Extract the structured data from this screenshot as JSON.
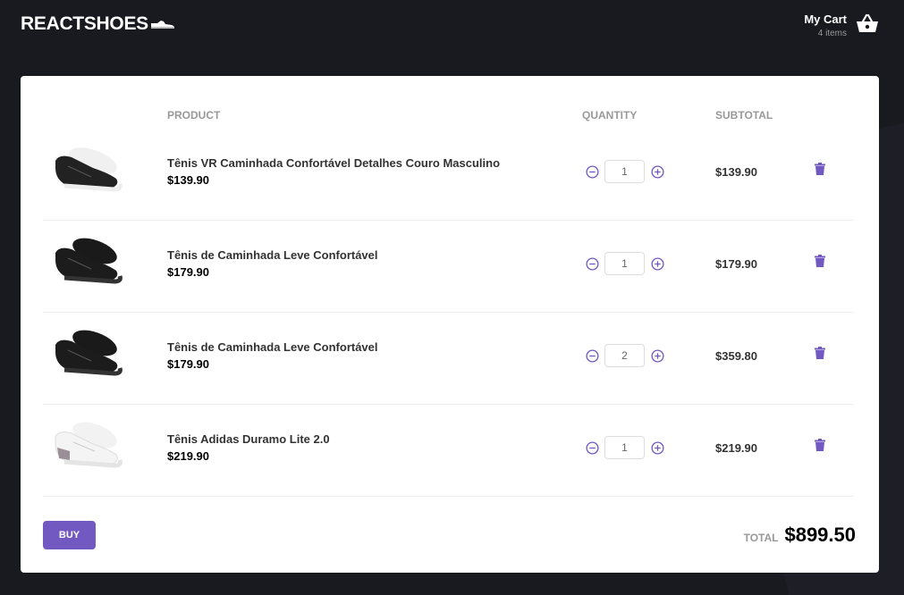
{
  "header": {
    "logo_text": "REACTSHOES",
    "cart_title": "My Cart",
    "cart_count": "4 items"
  },
  "table": {
    "headers": {
      "product": "PRODUCT",
      "quantity": "QUANTITY",
      "subtotal": "SUBTOTAL"
    },
    "rows": [
      {
        "name": "Tênis VR Caminhada Confortável Detalhes Couro Masculino",
        "price": "$139.90",
        "quantity": "1",
        "subtotal": "$139.90",
        "image": "black-shoe-white-sole"
      },
      {
        "name": "Tênis de Caminhada Leve Confortável",
        "price": "$179.90",
        "quantity": "1",
        "subtotal": "$179.90",
        "image": "all-black-shoe"
      },
      {
        "name": "Tênis de Caminhada Leve Confortável",
        "price": "$179.90",
        "quantity": "2",
        "subtotal": "$359.80",
        "image": "all-black-shoe"
      },
      {
        "name": "Tênis Adidas Duramo Lite 2.0",
        "price": "$219.90",
        "quantity": "1",
        "subtotal": "$219.90",
        "image": "white-shoe"
      }
    ]
  },
  "footer": {
    "buy_label": "BUY",
    "total_label": "TOTAL",
    "total_value": "$899.50"
  },
  "colors": {
    "background": "#191920",
    "accent": "#7159c1",
    "panel": "#ffffff"
  },
  "icons": {
    "decrement": "minus-circle-icon",
    "increment": "plus-circle-icon",
    "delete": "trash-icon",
    "cart": "basket-icon",
    "logo": "sneaker-icon"
  }
}
